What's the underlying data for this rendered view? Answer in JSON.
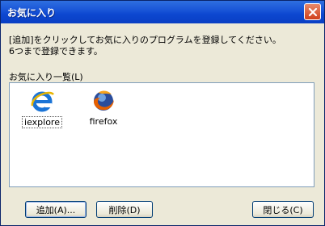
{
  "window": {
    "title": "お気に入り",
    "close_label": "×"
  },
  "description": {
    "line1": "[追加]をクリックしてお気に入りのプログラムを登録してください。",
    "line2": "6つまで登録できます。"
  },
  "favorites": {
    "label": "お気に入り一覧(L)",
    "items": [
      {
        "label": "iexplore",
        "icon": "internet-explorer-icon",
        "selected": true
      },
      {
        "label": "firefox",
        "icon": "firefox-icon",
        "selected": false
      }
    ]
  },
  "buttons": {
    "add": "追加(A)...",
    "delete": "削除(D)",
    "close": "閉じる(C)"
  }
}
